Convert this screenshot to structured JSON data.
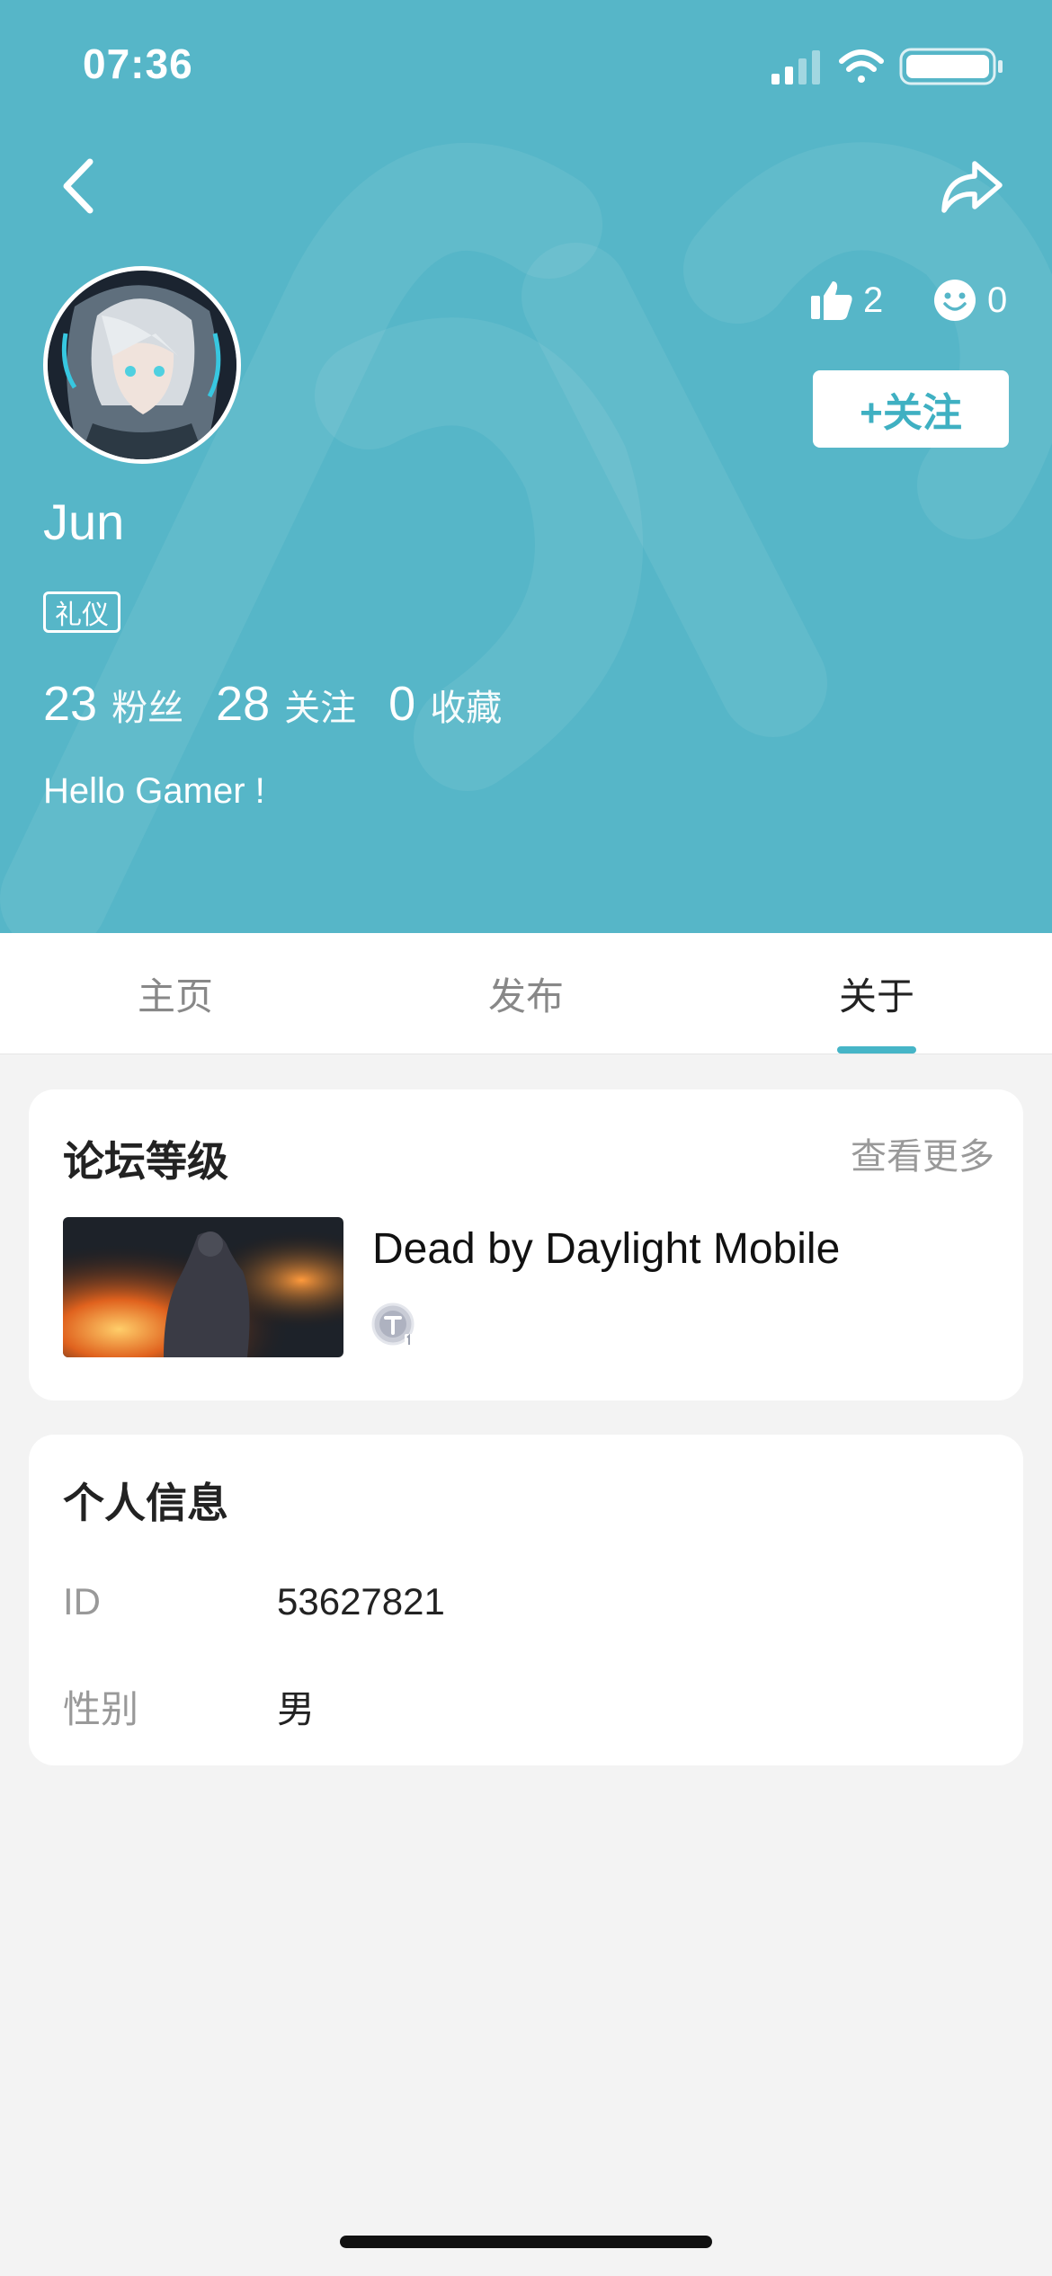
{
  "status_bar": {
    "time": "07:36"
  },
  "profile": {
    "username": "Jun",
    "tag": "礼仪",
    "likes": "2",
    "smiles": "0",
    "follow_label": "+关注",
    "stats": [
      {
        "value": "23",
        "label": "粉丝"
      },
      {
        "value": "28",
        "label": "关注"
      },
      {
        "value": "0",
        "label": "收藏"
      }
    ],
    "bio": "Hello Gamer !"
  },
  "tabs": [
    {
      "label": "主页",
      "active": false
    },
    {
      "label": "发布",
      "active": false
    },
    {
      "label": "关于",
      "active": true
    }
  ],
  "forum_level": {
    "title": "论坛等级",
    "more_label": "查看更多",
    "game_name": "Dead by Daylight Mobile"
  },
  "personal_info": {
    "title": "个人信息",
    "rows": [
      {
        "label": "ID",
        "value": "53627821"
      },
      {
        "label": "性别",
        "value": "男"
      }
    ]
  },
  "colors": {
    "header_bg": "#56b6c8",
    "accent": "#46b5c7",
    "page_bg": "#f3f3f3"
  }
}
